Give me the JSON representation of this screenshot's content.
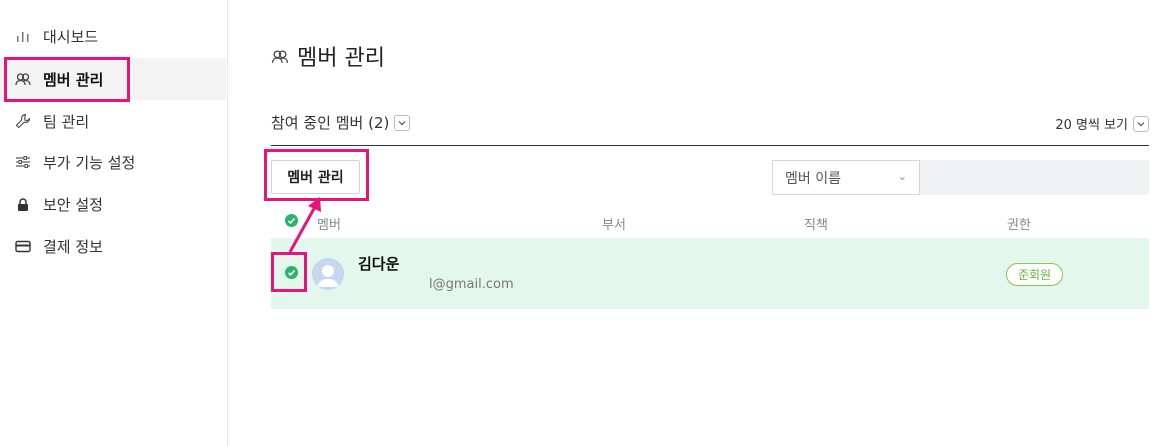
{
  "sidebar": {
    "items": [
      {
        "label": "대시보드",
        "icon": "bar-chart-icon"
      },
      {
        "label": "멤버 관리",
        "icon": "members-icon"
      },
      {
        "label": "팀 관리",
        "icon": "wrench-icon"
      },
      {
        "label": "부가 기능 설정",
        "icon": "sliders-icon"
      },
      {
        "label": "보안 설정",
        "icon": "lock-icon"
      },
      {
        "label": "결제 정보",
        "icon": "credit-card-icon"
      }
    ]
  },
  "page": {
    "title": "멤버 관리",
    "participating_label": "참여 중인 멤버 (2)",
    "per_page_label": "20 명씩 보기"
  },
  "toolbar": {
    "manage_button": "멤버 관리",
    "search_field_select": "멤버 이름",
    "search_value": ""
  },
  "table": {
    "headers": [
      "멤버",
      "부서",
      "직책",
      "권한"
    ],
    "rows": [
      {
        "name": "김다운",
        "email": "l@gmail.com",
        "department": "",
        "position": "",
        "role": "준회원",
        "selected": true
      }
    ]
  },
  "colors": {
    "highlight": "#e6157e",
    "check_green": "#2ab36b",
    "row_selected_bg": "#e3f7ec",
    "badge_green": "#5fb83a"
  }
}
